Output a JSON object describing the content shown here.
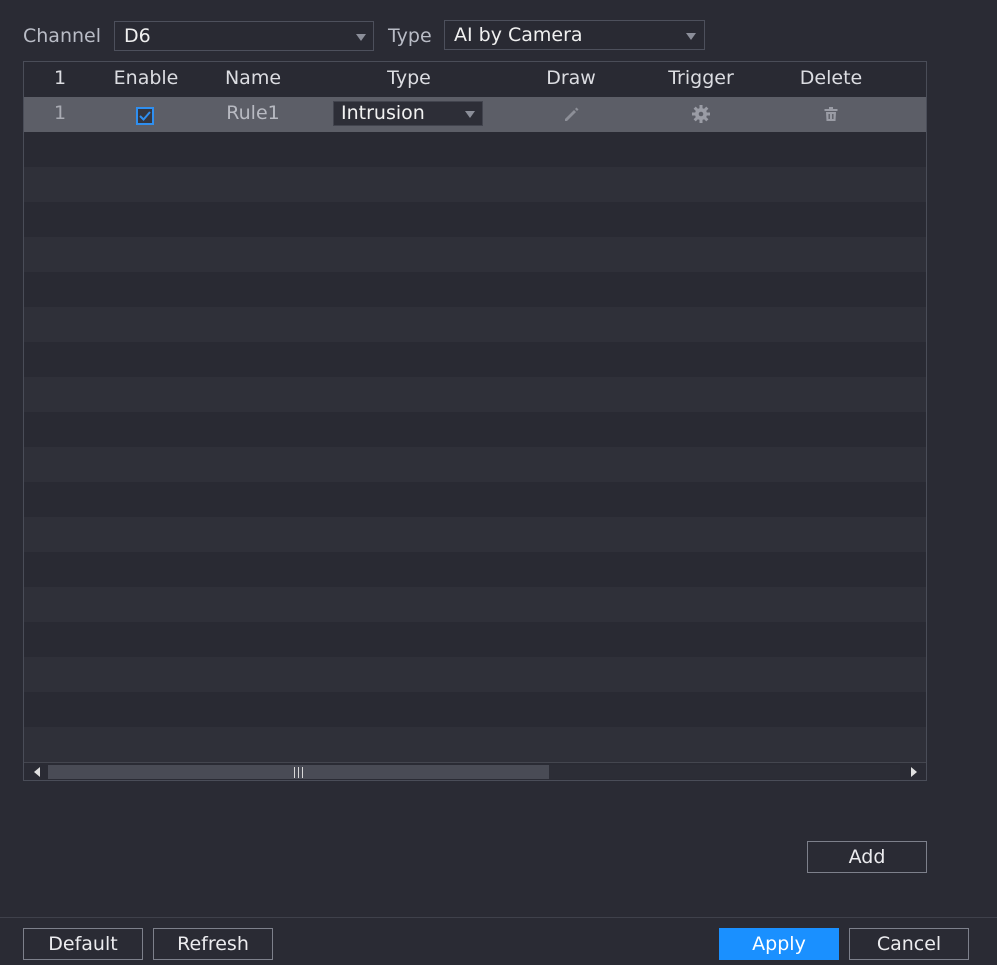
{
  "filter": {
    "channel_label": "Channel",
    "channel_value": "D6",
    "type_label": "Type",
    "type_value": "AI by Camera"
  },
  "table": {
    "headers": [
      "1",
      "Enable",
      "Name",
      "Type",
      "Draw",
      "Trigger",
      "Delete"
    ],
    "rows": [
      {
        "number": "1",
        "enabled": true,
        "name": "Rule1",
        "type": "Intrusion",
        "draw_icon": "pencil-icon",
        "trigger_icon": "gear-icon",
        "delete_icon": "trash-icon"
      }
    ]
  },
  "buttons": {
    "add": "Add",
    "default": "Default",
    "refresh": "Refresh",
    "apply": "Apply",
    "cancel": "Cancel"
  },
  "colors": {
    "background": "#2a2b34",
    "accent": "#1a90ff",
    "selected_row": "#5c5e67",
    "checkbox": "#2f8ff0"
  }
}
